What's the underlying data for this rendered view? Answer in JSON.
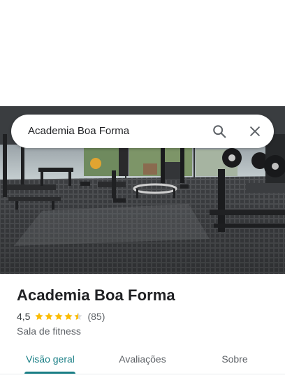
{
  "search": {
    "query": "Academia Boa Forma",
    "search_icon": "search-icon",
    "close_icon": "close-icon"
  },
  "photo": {
    "subject": "gym-interior-photo"
  },
  "place": {
    "title": "Academia Boa Forma",
    "rating": "4,5",
    "stars": 4.5,
    "review_count": "(85)",
    "category": "Sala de fitness"
  },
  "tabs": [
    {
      "label": "Visão geral",
      "active": true
    },
    {
      "label": "Avaliações",
      "active": false
    },
    {
      "label": "Sobre",
      "active": false
    }
  ],
  "colors": {
    "accent": "#1a7f86",
    "star": "#fbbc04",
    "star_empty": "#dadce0",
    "text_primary": "#202124",
    "text_secondary": "#5f6368"
  }
}
